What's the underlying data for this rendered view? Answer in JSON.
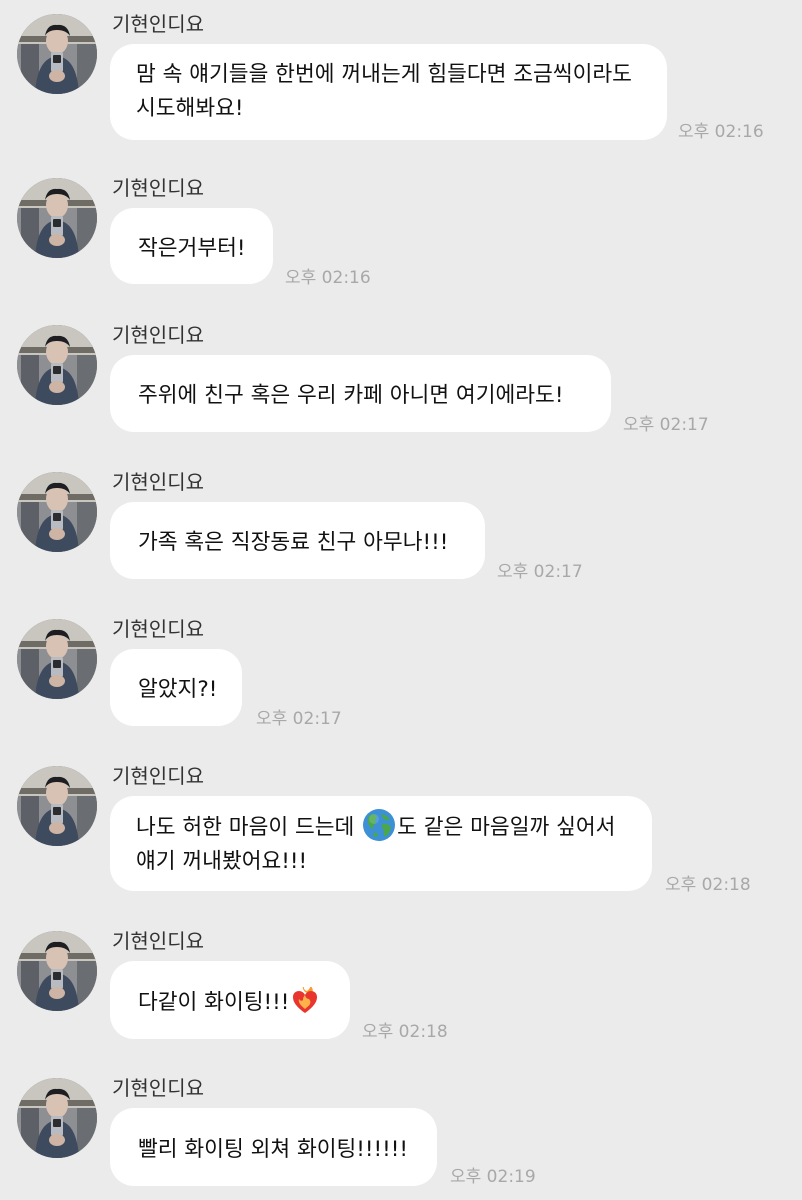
{
  "chat": {
    "colors": {
      "background": "#ebebeb",
      "bubble": "#ffffff",
      "time": "#a8a8a8",
      "sender": "#333333"
    },
    "messages": [
      {
        "sender": "기현인디요",
        "text": "맘 속 얘기들을 한번에 꺼내는게 힘들다면 조금씩이라도 시도해봐요!",
        "time": "오후 02:16"
      },
      {
        "sender": "기현인디요",
        "text": "작은거부터!",
        "time": "오후 02:16"
      },
      {
        "sender": "기현인디요",
        "text": "주위에 친구 혹은 우리 카페 아니면 여기에라도!",
        "time": "오후 02:17"
      },
      {
        "sender": "기현인디요",
        "text": "가족 혹은 직장동료 친구 아무나!!!",
        "time": "오후 02:17"
      },
      {
        "sender": "기현인디요",
        "text": "알았지?!",
        "time": "오후 02:17"
      },
      {
        "sender": "기현인디요",
        "text_before": "나도 허한 마음이 드는데 ",
        "emoji": "globe-emoji",
        "text_after": "도 같은 마음일까 싶어서 얘기 꺼내봤어요!!!",
        "time": "오후 02:18"
      },
      {
        "sender": "기현인디요",
        "text": "다같이 화이팅!!!",
        "emoji": "heart-on-fire-emoji",
        "time": "오후 02:18"
      },
      {
        "sender": "기현인디요",
        "text": "빨리 화이팅 외쳐 화이팅!!!!!!",
        "time": "오후 02:19"
      }
    ]
  }
}
